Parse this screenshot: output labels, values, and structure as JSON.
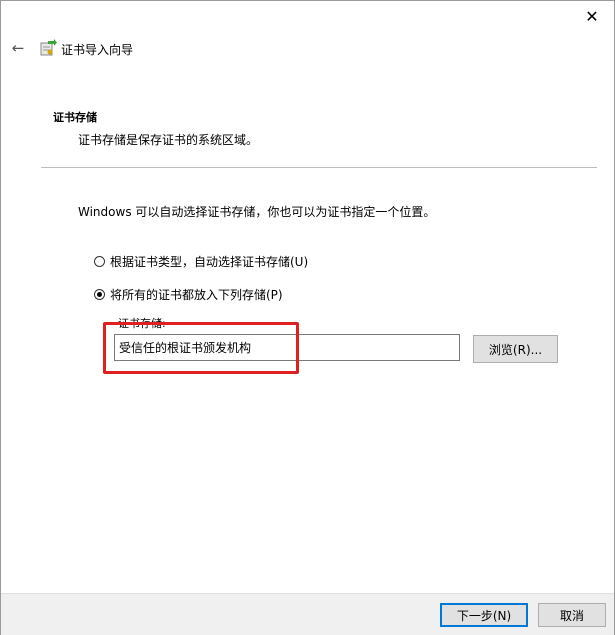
{
  "window": {
    "close_glyph": "✕"
  },
  "header": {
    "back_glyph": "←",
    "title": "证书导入向导",
    "icon": "certificate-import-icon"
  },
  "section": {
    "heading": "证书存储",
    "description": "证书存储是保存证书的系统区域。"
  },
  "main": {
    "intro": "Windows 可以自动选择证书存储，你也可以为证书指定一个位置。",
    "options": [
      {
        "label": "根据证书类型，自动选择证书存储(U)",
        "checked": false
      },
      {
        "label": "将所有的证书都放入下列存储(P)",
        "checked": true
      }
    ],
    "store_label": "证书存储:",
    "store_value": "受信任的根证书颁发机构",
    "browse_label": "浏览(R)..."
  },
  "footer": {
    "next_label": "下一步(N)",
    "cancel_label": "取消"
  },
  "colors": {
    "highlight": "#e02020",
    "accent": "#0078d7"
  }
}
